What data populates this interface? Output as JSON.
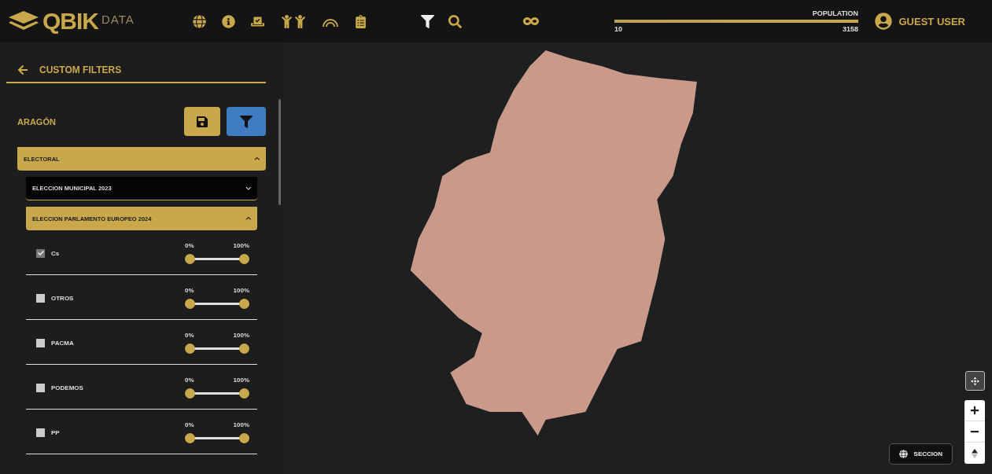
{
  "header": {
    "logo": {
      "brand": "QBIK",
      "suffix": "DATA"
    },
    "population": {
      "label": "POPULATION",
      "min": "10",
      "max": "3158",
      "level": 1
    },
    "user": {
      "name": "GUEST USER"
    }
  },
  "sidebar": {
    "title": "CUSTOM FILTERS",
    "region": "ARAGÓN",
    "sections": [
      {
        "label": "ELECTORAL",
        "expanded": true,
        "children": [
          {
            "label": "ELECCION MUNICIPAL 2023",
            "expanded": false
          },
          {
            "label": "ELECCION PARLAMENTO EUROPEO 2024",
            "expanded": true
          }
        ]
      }
    ],
    "parties": [
      {
        "name": "Cs",
        "checked": true,
        "min_label": "0%",
        "max_label": "100%",
        "level": 1
      },
      {
        "name": "OTROS",
        "checked": false,
        "min_label": "0%",
        "max_label": "100%",
        "level": 1
      },
      {
        "name": "PACMA",
        "checked": false,
        "min_label": "0%",
        "max_label": "100%",
        "level": 1
      },
      {
        "name": "PODEMOS",
        "checked": false,
        "min_label": "0%",
        "max_label": "100%",
        "level": 1
      },
      {
        "name": "PP",
        "checked": false,
        "min_label": "0%",
        "max_label": "100%",
        "level": 1
      }
    ]
  },
  "map": {
    "layer_button": "SECCION"
  }
}
